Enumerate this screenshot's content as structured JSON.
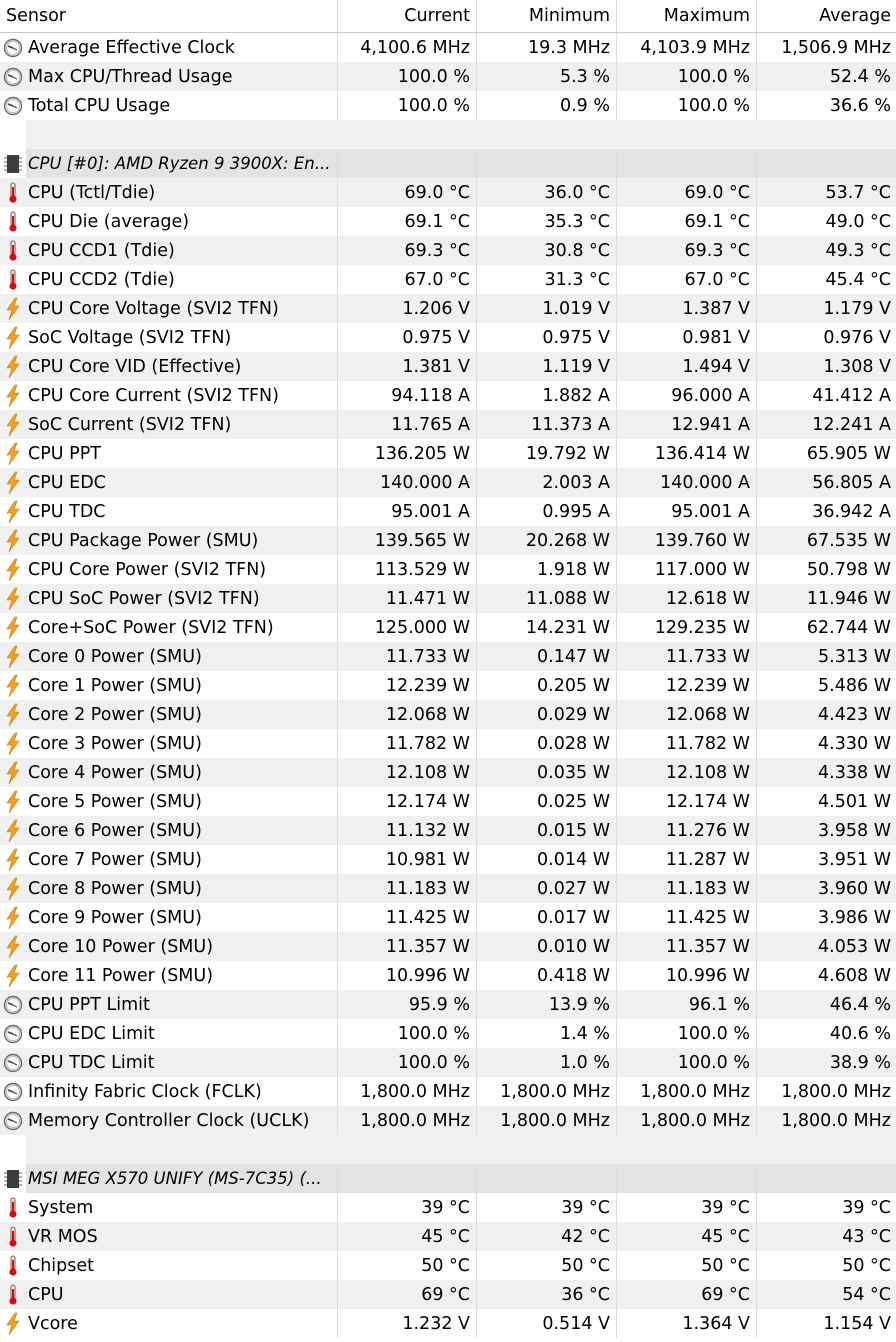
{
  "columns": [
    "Sensor",
    "Current",
    "Minimum",
    "Maximum",
    "Average"
  ],
  "colors": {
    "row_alt": "#f0f0f0",
    "group_header": "#e3e3e3",
    "thermometer_red": "#d01010",
    "bolt_orange": "#f4a01c",
    "clock_gray": "#808080"
  },
  "rows": [
    {
      "type": "sensor",
      "icon": "clock-icon",
      "name": "Average Effective Clock",
      "current": "4,100.6 MHz",
      "min": "19.3 MHz",
      "max": "4,103.9 MHz",
      "avg": "1,506.9 MHz"
    },
    {
      "type": "sensor",
      "icon": "clock-icon",
      "name": "Max CPU/Thread Usage",
      "current": "100.0 %",
      "min": "5.3 %",
      "max": "100.0 %",
      "avg": "52.4 %"
    },
    {
      "type": "sensor",
      "icon": "clock-icon",
      "name": "Total CPU Usage",
      "current": "100.0 %",
      "min": "0.9 %",
      "max": "100.0 %",
      "avg": "36.6 %"
    },
    {
      "type": "spacer"
    },
    {
      "type": "group",
      "icon": "chip-icon",
      "name": "CPU [#0]: AMD Ryzen 9 3900X: En..."
    },
    {
      "type": "sensor",
      "icon": "thermometer-icon",
      "name": "CPU (Tctl/Tdie)",
      "current": "69.0 °C",
      "min": "36.0 °C",
      "max": "69.0 °C",
      "avg": "53.7 °C"
    },
    {
      "type": "sensor",
      "icon": "thermometer-icon",
      "name": "CPU Die (average)",
      "current": "69.1 °C",
      "min": "35.3 °C",
      "max": "69.1 °C",
      "avg": "49.0 °C"
    },
    {
      "type": "sensor",
      "icon": "thermometer-icon",
      "name": "CPU CCD1 (Tdie)",
      "current": "69.3 °C",
      "min": "30.8 °C",
      "max": "69.3 °C",
      "avg": "49.3 °C"
    },
    {
      "type": "sensor",
      "icon": "thermometer-icon",
      "name": "CPU CCD2 (Tdie)",
      "current": "67.0 °C",
      "min": "31.3 °C",
      "max": "67.0 °C",
      "avg": "45.4 °C"
    },
    {
      "type": "sensor",
      "icon": "lightning-icon",
      "name": "CPU Core Voltage (SVI2 TFN)",
      "current": "1.206 V",
      "min": "1.019 V",
      "max": "1.387 V",
      "avg": "1.179 V"
    },
    {
      "type": "sensor",
      "icon": "lightning-icon",
      "name": "SoC Voltage (SVI2 TFN)",
      "current": "0.975 V",
      "min": "0.975 V",
      "max": "0.981 V",
      "avg": "0.976 V"
    },
    {
      "type": "sensor",
      "icon": "lightning-icon",
      "name": "CPU Core VID (Effective)",
      "current": "1.381 V",
      "min": "1.119 V",
      "max": "1.494 V",
      "avg": "1.308 V"
    },
    {
      "type": "sensor",
      "icon": "lightning-icon",
      "name": "CPU Core Current (SVI2 TFN)",
      "current": "94.118 A",
      "min": "1.882 A",
      "max": "96.000 A",
      "avg": "41.412 A"
    },
    {
      "type": "sensor",
      "icon": "lightning-icon",
      "name": "SoC Current (SVI2 TFN)",
      "current": "11.765 A",
      "min": "11.373 A",
      "max": "12.941 A",
      "avg": "12.241 A"
    },
    {
      "type": "sensor",
      "icon": "lightning-icon",
      "name": "CPU PPT",
      "current": "136.205 W",
      "min": "19.792 W",
      "max": "136.414 W",
      "avg": "65.905 W"
    },
    {
      "type": "sensor",
      "icon": "lightning-icon",
      "name": "CPU EDC",
      "current": "140.000 A",
      "min": "2.003 A",
      "max": "140.000 A",
      "avg": "56.805 A"
    },
    {
      "type": "sensor",
      "icon": "lightning-icon",
      "name": "CPU TDC",
      "current": "95.001 A",
      "min": "0.995 A",
      "max": "95.001 A",
      "avg": "36.942 A"
    },
    {
      "type": "sensor",
      "icon": "lightning-icon",
      "name": "CPU Package Power (SMU)",
      "current": "139.565 W",
      "min": "20.268 W",
      "max": "139.760 W",
      "avg": "67.535 W"
    },
    {
      "type": "sensor",
      "icon": "lightning-icon",
      "name": "CPU Core Power (SVI2 TFN)",
      "current": "113.529 W",
      "min": "1.918 W",
      "max": "117.000 W",
      "avg": "50.798 W"
    },
    {
      "type": "sensor",
      "icon": "lightning-icon",
      "name": "CPU SoC Power (SVI2 TFN)",
      "current": "11.471 W",
      "min": "11.088 W",
      "max": "12.618 W",
      "avg": "11.946 W"
    },
    {
      "type": "sensor",
      "icon": "lightning-icon",
      "name": "Core+SoC Power (SVI2 TFN)",
      "current": "125.000 W",
      "min": "14.231 W",
      "max": "129.235 W",
      "avg": "62.744 W"
    },
    {
      "type": "sensor",
      "icon": "lightning-icon",
      "name": "Core 0 Power (SMU)",
      "current": "11.733 W",
      "min": "0.147 W",
      "max": "11.733 W",
      "avg": "5.313 W"
    },
    {
      "type": "sensor",
      "icon": "lightning-icon",
      "name": "Core 1 Power (SMU)",
      "current": "12.239 W",
      "min": "0.205 W",
      "max": "12.239 W",
      "avg": "5.486 W"
    },
    {
      "type": "sensor",
      "icon": "lightning-icon",
      "name": "Core 2 Power (SMU)",
      "current": "12.068 W",
      "min": "0.029 W",
      "max": "12.068 W",
      "avg": "4.423 W"
    },
    {
      "type": "sensor",
      "icon": "lightning-icon",
      "name": "Core 3 Power (SMU)",
      "current": "11.782 W",
      "min": "0.028 W",
      "max": "11.782 W",
      "avg": "4.330 W"
    },
    {
      "type": "sensor",
      "icon": "lightning-icon",
      "name": "Core 4 Power (SMU)",
      "current": "12.108 W",
      "min": "0.035 W",
      "max": "12.108 W",
      "avg": "4.338 W"
    },
    {
      "type": "sensor",
      "icon": "lightning-icon",
      "name": "Core 5 Power (SMU)",
      "current": "12.174 W",
      "min": "0.025 W",
      "max": "12.174 W",
      "avg": "4.501 W"
    },
    {
      "type": "sensor",
      "icon": "lightning-icon",
      "name": "Core 6 Power (SMU)",
      "current": "11.132 W",
      "min": "0.015 W",
      "max": "11.276 W",
      "avg": "3.958 W"
    },
    {
      "type": "sensor",
      "icon": "lightning-icon",
      "name": "Core 7 Power (SMU)",
      "current": "10.981 W",
      "min": "0.014 W",
      "max": "11.287 W",
      "avg": "3.951 W"
    },
    {
      "type": "sensor",
      "icon": "lightning-icon",
      "name": "Core 8 Power (SMU)",
      "current": "11.183 W",
      "min": "0.027 W",
      "max": "11.183 W",
      "avg": "3.960 W"
    },
    {
      "type": "sensor",
      "icon": "lightning-icon",
      "name": "Core 9 Power (SMU)",
      "current": "11.425 W",
      "min": "0.017 W",
      "max": "11.425 W",
      "avg": "3.986 W"
    },
    {
      "type": "sensor",
      "icon": "lightning-icon",
      "name": "Core 10 Power (SMU)",
      "current": "11.357 W",
      "min": "0.010 W",
      "max": "11.357 W",
      "avg": "4.053 W"
    },
    {
      "type": "sensor",
      "icon": "lightning-icon",
      "name": "Core 11 Power (SMU)",
      "current": "10.996 W",
      "min": "0.418 W",
      "max": "10.996 W",
      "avg": "4.608 W"
    },
    {
      "type": "sensor",
      "icon": "clock-icon",
      "name": "CPU PPT Limit",
      "current": "95.9 %",
      "min": "13.9 %",
      "max": "96.1 %",
      "avg": "46.4 %"
    },
    {
      "type": "sensor",
      "icon": "clock-icon",
      "name": "CPU EDC Limit",
      "current": "100.0 %",
      "min": "1.4 %",
      "max": "100.0 %",
      "avg": "40.6 %"
    },
    {
      "type": "sensor",
      "icon": "clock-icon",
      "name": "CPU TDC Limit",
      "current": "100.0 %",
      "min": "1.0 %",
      "max": "100.0 %",
      "avg": "38.9 %"
    },
    {
      "type": "sensor",
      "icon": "clock-icon",
      "name": "Infinity Fabric Clock (FCLK)",
      "current": "1,800.0 MHz",
      "min": "1,800.0 MHz",
      "max": "1,800.0 MHz",
      "avg": "1,800.0 MHz"
    },
    {
      "type": "sensor",
      "icon": "clock-icon",
      "name": "Memory Controller Clock (UCLK)",
      "current": "1,800.0 MHz",
      "min": "1,800.0 MHz",
      "max": "1,800.0 MHz",
      "avg": "1,800.0 MHz"
    },
    {
      "type": "spacer"
    },
    {
      "type": "group",
      "icon": "chip-icon",
      "name": "MSI MEG X570 UNIFY (MS-7C35) (..."
    },
    {
      "type": "sensor",
      "icon": "thermometer-icon",
      "name": "System",
      "current": "39 °C",
      "min": "39 °C",
      "max": "39 °C",
      "avg": "39 °C"
    },
    {
      "type": "sensor",
      "icon": "thermometer-icon",
      "name": "VR MOS",
      "current": "45 °C",
      "min": "42 °C",
      "max": "45 °C",
      "avg": "43 °C"
    },
    {
      "type": "sensor",
      "icon": "thermometer-icon",
      "name": "Chipset",
      "current": "50 °C",
      "min": "50 °C",
      "max": "50 °C",
      "avg": "50 °C"
    },
    {
      "type": "sensor",
      "icon": "thermometer-icon",
      "name": "CPU",
      "current": "69 °C",
      "min": "36 °C",
      "max": "69 °C",
      "avg": "54 °C"
    },
    {
      "type": "sensor",
      "icon": "lightning-icon",
      "name": "Vcore",
      "current": "1.232 V",
      "min": "0.514 V",
      "max": "1.364 V",
      "avg": "1.154 V"
    }
  ]
}
